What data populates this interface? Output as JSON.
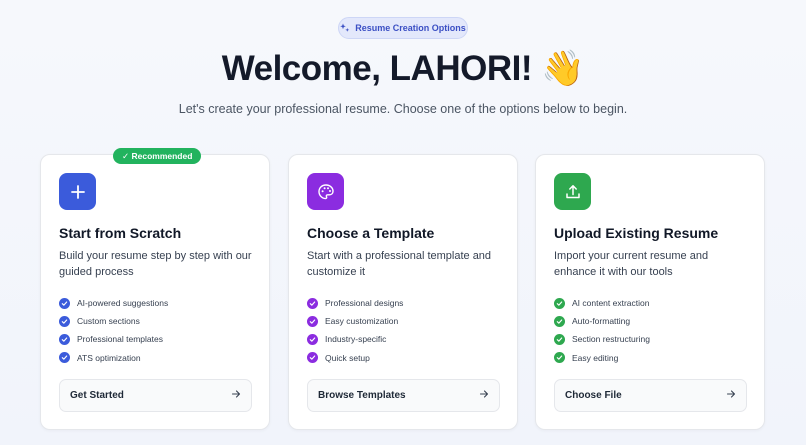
{
  "header": {
    "pill_label": "Resume Creation Options",
    "title": "Welcome, LAHORI! 👋",
    "subtitle": "Let's create your professional resume. Choose one of the options below to begin."
  },
  "colors": {
    "blue": "#3b5bdb",
    "purple": "#8b2ce0",
    "green": "#2ea84f",
    "badge_green": "#22b35e"
  },
  "cards": [
    {
      "badge": "✓ Recommended",
      "icon": "plus-icon",
      "title": "Start from Scratch",
      "description": "Build your resume step by step with our guided process",
      "features": [
        "AI-powered suggestions",
        "Custom sections",
        "Professional templates",
        "ATS optimization"
      ],
      "action_label": "Get Started"
    },
    {
      "icon": "palette-icon",
      "title": "Choose a Template",
      "description": "Start with a professional template and customize it",
      "features": [
        "Professional designs",
        "Easy customization",
        "Industry-specific",
        "Quick setup"
      ],
      "action_label": "Browse Templates"
    },
    {
      "icon": "upload-icon",
      "title": "Upload Existing Resume",
      "description": "Import your current resume and enhance it with our tools",
      "features": [
        "AI content extraction",
        "Auto-formatting",
        "Section restructuring",
        "Easy editing"
      ],
      "action_label": "Choose File"
    }
  ]
}
